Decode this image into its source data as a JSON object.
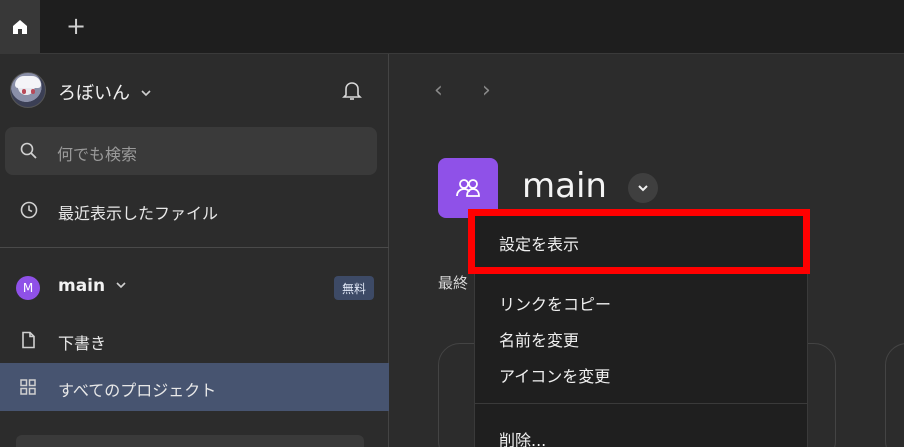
{
  "tabbar": {
    "home_icon": "home-icon",
    "add_tab": "+"
  },
  "sidebar": {
    "user": {
      "name": "ろぼいん",
      "chevron": "⌄"
    },
    "search": {
      "placeholder": "何でも検索"
    },
    "recent": {
      "label": "最近表示したファイル"
    },
    "team": {
      "initial": "M",
      "name": "main",
      "chevron": "⌄",
      "plan_badge": "無料"
    },
    "nav": {
      "drafts": "下書き",
      "all_projects": "すべてのプロジェクト"
    }
  },
  "main": {
    "back": "‹",
    "forward": "›",
    "team_title": "main",
    "last_label": "最終"
  },
  "menu": {
    "items": [
      {
        "label": "設定を表示"
      },
      {
        "label": "リンクをコピー"
      },
      {
        "label": "名前を変更"
      },
      {
        "label": "アイコンを変更"
      },
      {
        "label": "削除..."
      }
    ]
  },
  "colors": {
    "accent_purple": "#8f51e8",
    "selected_nav": "#475470",
    "highlight_box": "#ff0000"
  }
}
